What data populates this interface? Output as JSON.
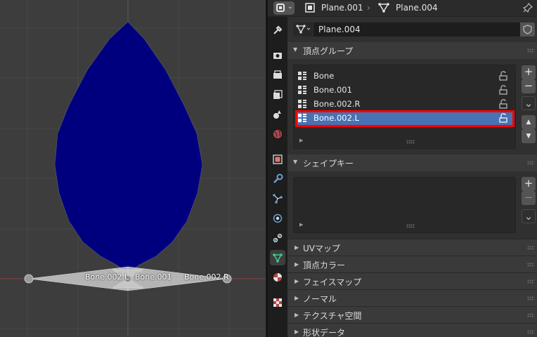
{
  "viewport": {
    "bone_labels": [
      "Bone.002.L",
      "Bone.001",
      "Bone.002.R"
    ]
  },
  "header": {
    "breadcrumb_object": "Plane.001",
    "breadcrumb_data": "Plane.004"
  },
  "mesh_name": "Plane.004",
  "vertex_groups": {
    "title": "頂点グループ",
    "items": [
      {
        "label": "Bone"
      },
      {
        "label": "Bone.001"
      },
      {
        "label": "Bone.002.R"
      },
      {
        "label": "Bone.002.L",
        "selected": true
      }
    ],
    "add_label": "+",
    "remove_label": "−",
    "specials_label": "⌄",
    "move_up_label": "▲",
    "move_down_label": "▼"
  },
  "shape_keys": {
    "title": "シェイプキー",
    "add_label": "+",
    "remove_label": "−",
    "specials_label": "⌄"
  },
  "collapsed_panels": [
    "UVマップ",
    "頂点カラー",
    "フェイスマップ",
    "ノーマル",
    "テクスチャ空間",
    "形状データ"
  ],
  "icons": {
    "tabs": [
      "tool-icon",
      "render-icon",
      "output-icon",
      "view-layer-icon",
      "scene-icon",
      "world-icon",
      "object-icon",
      "modifier-icon",
      "particles-icon",
      "physics-icon",
      "constraints-icon",
      "object-data-icon",
      "material-icon",
      "texture-icon"
    ]
  },
  "colors": {
    "mesh_fill": "#00007f",
    "selection": "#4772b3",
    "highlight": "#ff0000"
  }
}
